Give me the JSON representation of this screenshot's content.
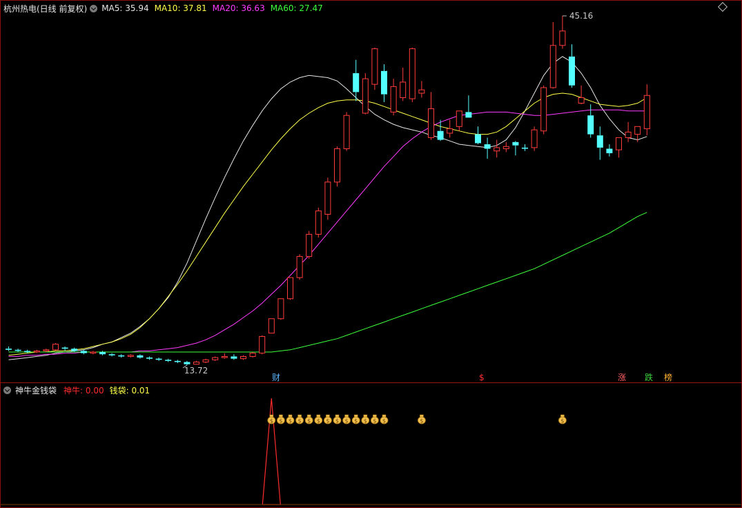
{
  "main_panel": {
    "title": "杭州热电(日线 前复权)",
    "indicators": [
      {
        "label": "MA5: 35.94",
        "color": "#e6e6e6"
      },
      {
        "label": "MA10: 37.81",
        "color": "#ffff4a"
      },
      {
        "label": "MA20: 36.63",
        "color": "#ff3cff"
      },
      {
        "label": "MA60: 27.47",
        "color": "#3cff3c"
      }
    ],
    "high_label": "45.16",
    "low_label": "13.72",
    "markers": [
      {
        "text": "财",
        "color": "#5ab4ff"
      },
      {
        "text": "$",
        "color": "#ff3030"
      },
      {
        "text": "涨",
        "color": "#ff6060"
      },
      {
        "text": "跌",
        "color": "#3cd23c"
      },
      {
        "text": "榜",
        "color": "#ffb030"
      }
    ],
    "colors": {
      "up": "#ff3c3c",
      "down": "#54ffff",
      "ma5": "#e6e6e6",
      "ma10": "#ffff4a",
      "ma20": "#ff3cff",
      "ma60": "#3cff3c"
    }
  },
  "sub_panel": {
    "title": "神牛金钱袋",
    "indicators": [
      {
        "label": "神牛: 0.00",
        "color": "#ff2b2b"
      },
      {
        "label": "钱袋: 0.01",
        "color": "#ffff4a"
      }
    ],
    "bag_icon": "money-bag-icon"
  },
  "chart_data": {
    "type": "candlestick",
    "candles": [
      [
        15.2,
        15.4,
        15.0,
        15.1
      ],
      [
        15.1,
        15.2,
        14.9,
        15.0
      ],
      [
        15.0,
        15.1,
        14.8,
        14.9
      ],
      [
        14.9,
        15.1,
        14.8,
        15.0
      ],
      [
        15.0,
        15.2,
        14.9,
        15.1
      ],
      [
        15.1,
        15.7,
        15.0,
        15.6
      ],
      [
        15.3,
        15.4,
        15.0,
        15.2
      ],
      [
        15.2,
        15.3,
        14.9,
        15.0
      ],
      [
        15.0,
        15.1,
        14.7,
        14.8
      ],
      [
        14.8,
        15.0,
        14.7,
        14.9
      ],
      [
        14.9,
        15.0,
        14.6,
        14.7
      ],
      [
        14.7,
        14.8,
        14.5,
        14.6
      ],
      [
        14.6,
        14.7,
        14.4,
        14.5
      ],
      [
        14.5,
        14.7,
        14.4,
        14.6
      ],
      [
        14.6,
        14.7,
        14.3,
        14.4
      ],
      [
        14.4,
        14.5,
        14.2,
        14.3
      ],
      [
        14.3,
        14.4,
        14.1,
        14.2
      ],
      [
        14.2,
        14.3,
        14.0,
        14.1
      ],
      [
        14.1,
        14.2,
        13.9,
        14.0
      ],
      [
        14.0,
        14.1,
        13.72,
        13.8
      ],
      [
        13.8,
        14.1,
        13.8,
        14.0
      ],
      [
        14.0,
        14.3,
        13.9,
        14.2
      ],
      [
        14.2,
        14.5,
        14.1,
        14.4
      ],
      [
        14.4,
        14.8,
        14.3,
        14.5
      ],
      [
        14.5,
        14.7,
        14.2,
        14.3
      ],
      [
        14.3,
        14.6,
        14.2,
        14.5
      ],
      [
        14.5,
        14.9,
        14.4,
        14.8
      ],
      [
        14.8,
        16.4,
        14.7,
        16.3
      ],
      [
        16.6,
        17.9,
        16.6,
        17.9
      ],
      [
        17.9,
        19.7,
        17.8,
        19.7
      ],
      [
        19.7,
        21.6,
        19.6,
        21.6
      ],
      [
        21.6,
        23.7,
        21.4,
        23.5
      ],
      [
        23.5,
        25.8,
        23.3,
        25.5
      ],
      [
        25.5,
        27.9,
        25.2,
        27.6
      ],
      [
        27.3,
        30.6,
        26.8,
        30.2
      ],
      [
        30.2,
        33.4,
        29.8,
        33.2
      ],
      [
        33.2,
        36.5,
        33.0,
        36.2
      ],
      [
        40.0,
        41.2,
        37.5,
        38.3
      ],
      [
        36.4,
        40.0,
        36.3,
        39.5
      ],
      [
        39.0,
        42.3,
        38.5,
        42.2
      ],
      [
        40.2,
        40.8,
        37.4,
        38.1
      ],
      [
        36.5,
        39.5,
        36.2,
        38.8
      ],
      [
        37.8,
        40.5,
        37.5,
        39.2
      ],
      [
        37.7,
        42.3,
        37.4,
        42.2
      ],
      [
        38.2,
        39.3,
        37.8,
        38.5
      ],
      [
        34.2,
        38.3,
        34.0,
        36.8
      ],
      [
        34.8,
        35.8,
        33.9,
        34.0
      ],
      [
        34.6,
        35.8,
        34.2,
        35.0
      ],
      [
        35.2,
        36.6,
        34.8,
        36.6
      ],
      [
        36.5,
        38.0,
        36.1,
        36.0
      ],
      [
        34.5,
        35.2,
        33.6,
        33.7
      ],
      [
        33.6,
        34.2,
        32.3,
        33.2
      ],
      [
        33.0,
        34.0,
        32.4,
        33.3
      ],
      [
        33.2,
        33.8,
        32.9,
        33.4
      ],
      [
        33.8,
        33.9,
        32.6,
        33.5
      ],
      [
        33.3,
        33.6,
        33.0,
        33.2
      ],
      [
        33.3,
        35.2,
        33.0,
        34.9
      ],
      [
        34.8,
        38.9,
        34.5,
        38.7
      ],
      [
        38.7,
        44.6,
        38.6,
        42.5
      ],
      [
        42.5,
        45.16,
        42.2,
        43.8
      ],
      [
        41.5,
        42.6,
        38.7,
        38.9
      ],
      [
        37.3,
        38.9,
        37.2,
        37.8
      ],
      [
        36.2,
        37.2,
        34.2,
        34.5
      ],
      [
        34.4,
        35.2,
        32.2,
        33.3
      ],
      [
        33.2,
        33.6,
        32.5,
        32.8
      ],
      [
        33.1,
        34.2,
        32.4,
        34.2
      ],
      [
        34.2,
        35.6,
        33.8,
        34.7
      ],
      [
        34.5,
        35.1,
        33.8,
        35.2
      ],
      [
        35.0,
        39.0,
        34.4,
        38.0
      ]
    ],
    "ma": {
      "MA5": [
        14.2,
        14.3,
        14.4,
        14.5,
        14.6,
        14.8,
        14.9,
        15.0,
        15.1,
        15.3,
        15.6,
        15.8,
        16.2,
        16.6,
        17.2,
        17.9,
        18.8,
        19.8,
        21.2,
        22.9,
        24.9,
        26.9,
        28.8,
        30.6,
        32.3,
        33.9,
        35.3,
        36.6,
        37.7,
        38.6,
        39.2,
        39.6,
        39.8,
        39.7,
        39.6,
        39.3,
        38.6,
        37.8,
        37.0,
        36.3,
        35.8,
        35.4,
        35.1,
        34.9,
        34.7,
        34.4,
        34.2,
        33.9,
        33.6,
        33.5,
        33.4,
        33.3,
        33.5,
        34.0,
        35.1,
        36.6,
        38.2,
        39.8,
        40.9,
        41.5,
        41.0,
        40.0,
        38.7,
        37.1,
        35.9,
        34.9,
        34.2,
        34.0,
        34.3
      ],
      "MA10": [
        14.3,
        14.4,
        14.5,
        14.6,
        14.7,
        14.8,
        14.9,
        14.9,
        15.0,
        15.0,
        15.1,
        15.2,
        15.4,
        15.6,
        15.8,
        16.1,
        16.5,
        17.1,
        17.9,
        18.8,
        19.9,
        21.0,
        22.2,
        23.5,
        24.8,
        26.1,
        27.4,
        28.6,
        29.8,
        30.9,
        32.0,
        33.1,
        34.1,
        35.0,
        35.8,
        36.4,
        36.9,
        37.3,
        37.5,
        37.6,
        37.6,
        37.5,
        37.3,
        37.0,
        36.7,
        36.4,
        36.1,
        35.8,
        35.5,
        35.2,
        35.0,
        34.8,
        34.6,
        34.5,
        34.5,
        34.7,
        35.2,
        35.9,
        36.6,
        37.3,
        37.8,
        38.1,
        38.2,
        38.1,
        37.8,
        37.5,
        37.2,
        37.1,
        37.0,
        37.1,
        37.3,
        37.8
      ],
      "MA20": [
        14.5,
        14.5,
        14.6,
        14.6,
        14.7,
        14.7,
        14.8,
        14.8,
        14.9,
        14.9,
        14.9,
        14.9,
        14.9,
        14.9,
        15.0,
        15.0,
        15.1,
        15.2,
        15.3,
        15.5,
        15.7,
        16.0,
        16.4,
        16.9,
        17.4,
        18.0,
        18.6,
        19.3,
        20.1,
        20.9,
        21.8,
        22.7,
        23.6,
        24.6,
        25.6,
        26.6,
        27.6,
        28.6,
        29.6,
        30.6,
        31.6,
        32.5,
        33.4,
        34.1,
        34.7,
        35.2,
        35.6,
        35.9,
        36.2,
        36.3,
        36.4,
        36.5,
        36.5,
        36.5,
        36.4,
        36.3,
        36.2,
        36.2,
        36.3,
        36.4,
        36.5,
        36.6,
        36.7,
        36.7,
        36.7,
        36.7,
        36.6,
        36.6,
        36.6
      ],
      "MA60": [
        14.9,
        14.9,
        14.9,
        14.9,
        14.9,
        14.9,
        14.9,
        14.9,
        14.9,
        14.9,
        14.9,
        14.9,
        14.9,
        14.9,
        14.9,
        14.9,
        14.9,
        14.9,
        14.9,
        14.9,
        14.9,
        14.9,
        14.9,
        14.9,
        14.9,
        14.9,
        14.9,
        14.9,
        14.9,
        14.9,
        15.0,
        15.1,
        15.3,
        15.5,
        15.7,
        15.9,
        16.1,
        16.4,
        16.7,
        17.0,
        17.3,
        17.6,
        17.9,
        18.2,
        18.5,
        18.8,
        19.1,
        19.4,
        19.7,
        20.0,
        20.3,
        20.6,
        20.9,
        21.2,
        21.5,
        21.8,
        22.1,
        22.4,
        22.8,
        23.2,
        23.6,
        24.0,
        24.4,
        24.8,
        25.2,
        25.6,
        26.1,
        26.6,
        27.1,
        27.47
      ]
    },
    "shenniu_signal_index": 28,
    "qiandai_signal_indices": [
      28,
      29,
      30,
      31,
      32,
      33,
      34,
      35,
      36,
      37,
      38,
      39,
      40,
      44,
      59
    ]
  }
}
